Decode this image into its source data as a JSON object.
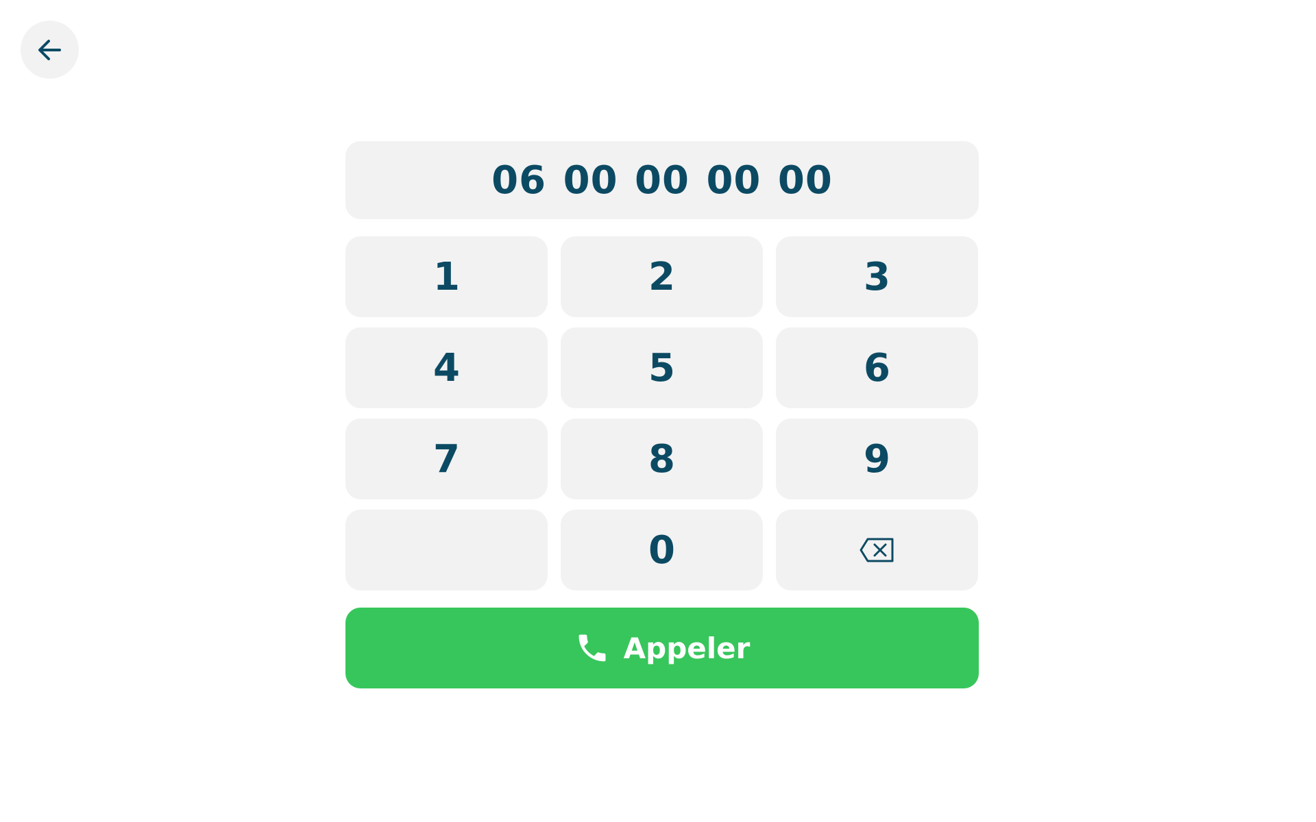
{
  "header": {
    "back_icon": "arrow-left-icon"
  },
  "display": {
    "number": "06 00 00 00 00"
  },
  "keypad": {
    "keys": [
      "1",
      "2",
      "3",
      "4",
      "5",
      "6",
      "7",
      "8",
      "9",
      "",
      "0"
    ],
    "backspace_icon": "backspace-icon"
  },
  "call": {
    "label": "Appeler",
    "icon": "phone-icon"
  },
  "colors": {
    "primary_text": "#0c4a63",
    "key_background": "#f2f2f2",
    "call_green": "#37c65b",
    "call_text": "#ffffff"
  }
}
